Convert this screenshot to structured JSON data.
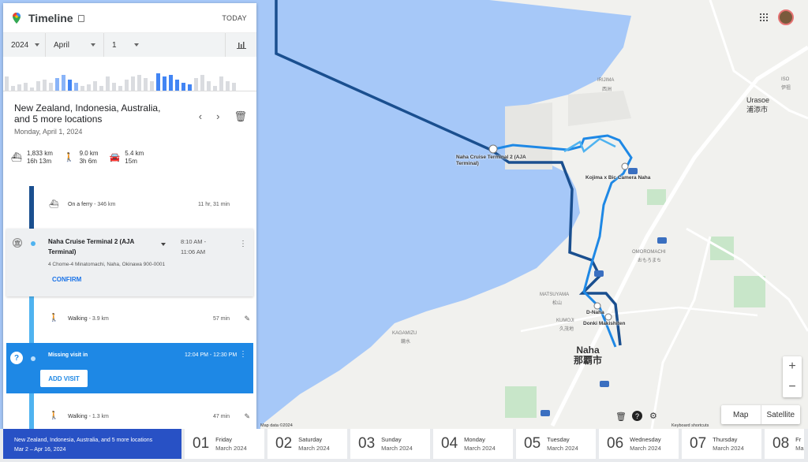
{
  "app": {
    "title": "Timeline",
    "today_label": "TODAY"
  },
  "date_selectors": {
    "year": "2024",
    "month": "April",
    "day": "1"
  },
  "histogram": {
    "colors": {
      "light": "#dadce0",
      "highlight": "#4285f4",
      "mid": "#8ab4f8"
    }
  },
  "summary": {
    "title": "New Zealand, Indonesia, Australia, and 5 more locations",
    "date": "Monday, April 1, 2024"
  },
  "stats": [
    {
      "icon": "ferry-icon",
      "distance": "1,833 km",
      "time": "16h 13m"
    },
    {
      "icon": "walk-icon",
      "distance": "9.0 km",
      "time": "3h 6m"
    },
    {
      "icon": "car-icon",
      "distance": "5.4 km",
      "time": "15m"
    }
  ],
  "timeline": {
    "ferry": {
      "label": "On a ferry",
      "distance": " - 346 km",
      "duration": "11 hr, 31 min"
    },
    "visit": {
      "place": "Naha Cruise Terminal 2 (AJA Terminal)",
      "time_start": "8:10 AM -",
      "time_end": "11:06 AM",
      "address": "4 Chome-4 Minatomachi, Naha, Okinawa 900-0001",
      "confirm": "CONFIRM"
    },
    "walk1": {
      "label": "Walking",
      "distance": " - 3.9 km",
      "duration": "57 min"
    },
    "missing": {
      "label": "Missing visit in",
      "time": "12:04 PM - 12:30 PM",
      "add": "ADD VISIT",
      "icon": "?"
    },
    "walk2": {
      "label": "Walking",
      "distance": " - 1.3 km",
      "duration": "47 min"
    }
  },
  "trip": {
    "title": "New Zealand, Indonesia, Australia, and 5 more locations",
    "range": "Mar 2 – Apr 16, 2024"
  },
  "days": [
    {
      "num": "01",
      "weekday": "Friday",
      "month": "March 2024"
    },
    {
      "num": "02",
      "weekday": "Saturday",
      "month": "March 2024"
    },
    {
      "num": "03",
      "weekday": "Sunday",
      "month": "March 2024"
    },
    {
      "num": "04",
      "weekday": "Monday",
      "month": "March 2024"
    },
    {
      "num": "05",
      "weekday": "Tuesday",
      "month": "March 2024"
    },
    {
      "num": "06",
      "weekday": "Wednesday",
      "month": "March 2024"
    },
    {
      "num": "07",
      "weekday": "Thursday",
      "month": "March 2024"
    },
    {
      "num": "08",
      "weekday": "Fr",
      "month": "Ma"
    }
  ],
  "map": {
    "labels": {
      "cruise": "Naha Cruise Terminal 2 (AJA Terminal)",
      "kojima": "Kojima x Bic Camera Naha",
      "dnaha": "D-Naha",
      "donki": "Donki Makishiten",
      "irijima": "IRIJIMA",
      "irijima_jp": "西洲",
      "urasoe": "Urasoe",
      "urasoe_jp": "浦添市",
      "omoromachi": "OMOROMACHI",
      "omoromachi_jp": "おもろまち",
      "matsuyama": "MATSUYAMA",
      "matsuyama_jp": "松山",
      "kumoji": "KUMOJI",
      "kumoji_jp": "久茂地",
      "kagamizu": "KAGAMIZU",
      "kagamizu_jp": "鏡水",
      "naha": "Naha",
      "naha_jp": "那覇市",
      "iso": "ISO",
      "iso_jp": "伊祖"
    },
    "type_map": "Map",
    "type_satellite": "Satellite",
    "zoom_in": "+",
    "zoom_out": "−",
    "map_data": "Map data ©2024",
    "shortcuts": "Keyboard shortcuts"
  }
}
